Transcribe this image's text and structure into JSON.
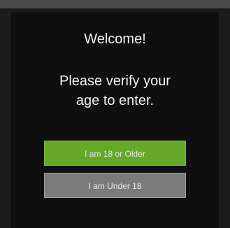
{
  "dialog": {
    "title": "Welcome!",
    "message_line1": "Please verify your",
    "message_line2": "age to enter."
  },
  "buttons": {
    "adult_label": "I am 18 or Older",
    "minor_label": "I am Under 18"
  },
  "colors": {
    "background": "#1b1b1b",
    "modal": "#0f0f0f",
    "adult_button": "#66a92a",
    "minor_button": "#7b7b7b",
    "text": "#f2f2f2"
  }
}
